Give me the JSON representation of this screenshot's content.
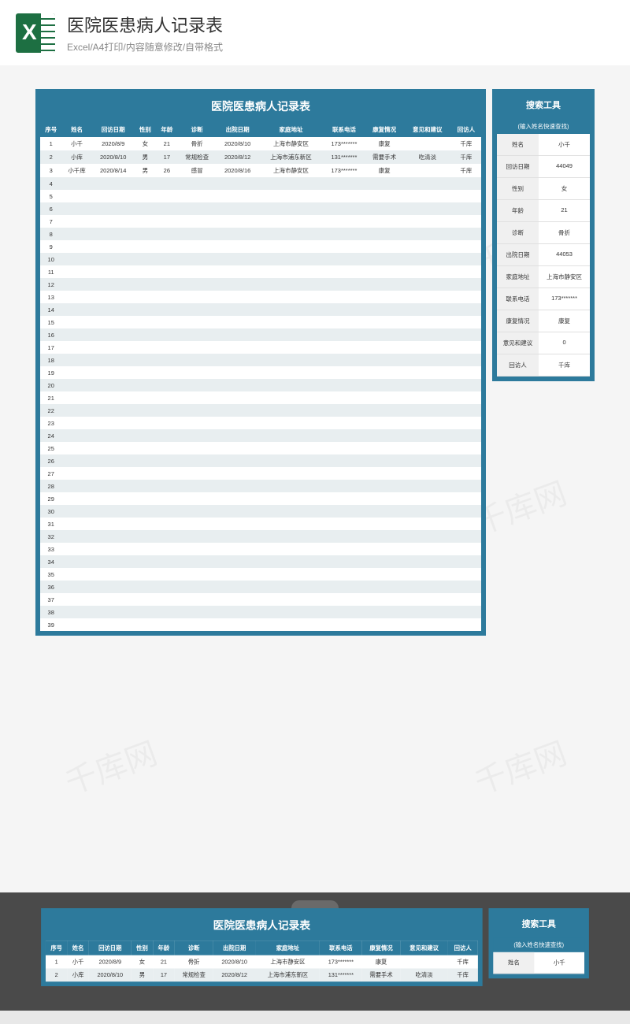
{
  "header": {
    "title": "医院医患病人记录表",
    "subtitle": "Excel/A4打印/内容随意修改/自带格式"
  },
  "watermark": "千库网",
  "main": {
    "title": "医院医患病人记录表",
    "columns": [
      "序号",
      "姓名",
      "回访日期",
      "性别",
      "年龄",
      "诊断",
      "出院日期",
      "家庭地址",
      "联系电话",
      "康复情况",
      "意见和建议",
      "回访人"
    ],
    "rows": [
      {
        "no": "1",
        "name": "小千",
        "visit": "2020/8/9",
        "sex": "女",
        "age": "21",
        "diag": "骨折",
        "discharge": "2020/8/10",
        "addr": "上海市静安区",
        "tel": "173*******",
        "recover": "康复",
        "suggest": "",
        "visitor": "千库"
      },
      {
        "no": "2",
        "name": "小库",
        "visit": "2020/8/10",
        "sex": "男",
        "age": "17",
        "diag": "常规检查",
        "discharge": "2020/8/12",
        "addr": "上海市浦东新区",
        "tel": "131*******",
        "recover": "需要手术",
        "suggest": "吃清淡",
        "visitor": "千库"
      },
      {
        "no": "3",
        "name": "小千库",
        "visit": "2020/8/14",
        "sex": "男",
        "age": "26",
        "diag": "感冒",
        "discharge": "2020/8/16",
        "addr": "上海市静安区",
        "tel": "173*******",
        "recover": "康复",
        "suggest": "",
        "visitor": "千库"
      }
    ],
    "empty_rows": 36
  },
  "side": {
    "title": "搜索工具",
    "hint": "(输入姓名快速查找)",
    "fields": [
      {
        "label": "姓名",
        "value": "小千"
      },
      {
        "label": "回访日期",
        "value": "44049"
      },
      {
        "label": "性别",
        "value": "女"
      },
      {
        "label": "年龄",
        "value": "21"
      },
      {
        "label": "诊断",
        "value": "骨折"
      },
      {
        "label": "出院日期",
        "value": "44053"
      },
      {
        "label": "家庭地址",
        "value": "上海市静安区"
      },
      {
        "label": "联系电话",
        "value": "173*******"
      },
      {
        "label": "康复情况",
        "value": "康复"
      },
      {
        "label": "意见和建议",
        "value": "0"
      },
      {
        "label": "回访人",
        "value": "千库"
      }
    ]
  }
}
